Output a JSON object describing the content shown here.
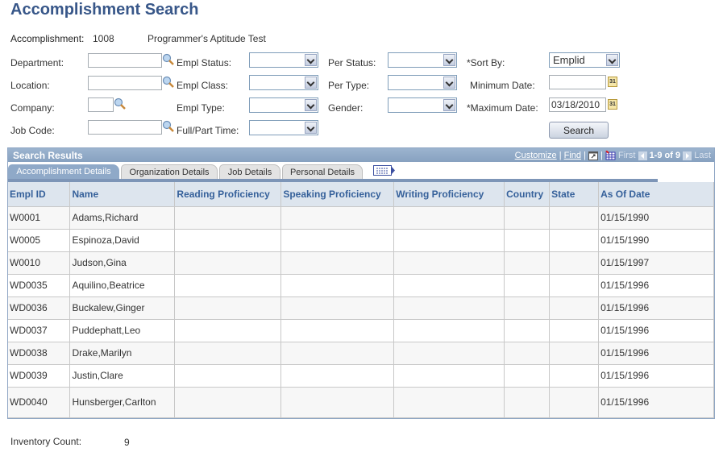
{
  "page": {
    "title": "Accomplishment Search"
  },
  "accomplishment": {
    "label": "Accomplishment:",
    "code": "1008",
    "description": "Programmer's Aptitude Test"
  },
  "criteria": {
    "department": {
      "label": "Department:",
      "value": ""
    },
    "location": {
      "label": "Location:",
      "value": ""
    },
    "company": {
      "label": "Company:",
      "value": ""
    },
    "job_code": {
      "label": "Job Code:",
      "value": ""
    },
    "empl_status": {
      "label": "Empl Status:",
      "value": ""
    },
    "empl_class": {
      "label": "Empl Class:",
      "value": ""
    },
    "empl_type": {
      "label": "Empl Type:",
      "value": ""
    },
    "full_part_time": {
      "label": "Full/Part Time:",
      "value": ""
    },
    "per_status": {
      "label": "Per Status:",
      "value": ""
    },
    "per_type": {
      "label": "Per Type:",
      "value": ""
    },
    "gender": {
      "label": "Gender:",
      "value": ""
    },
    "sort_by": {
      "label": "*Sort By:",
      "value": "Emplid"
    },
    "minimum_date": {
      "label": "Minimum Date:",
      "value": ""
    },
    "maximum_date": {
      "label": "*Maximum Date:",
      "value": "03/18/2010"
    },
    "search_button": "Search",
    "calendar_glyph": "31"
  },
  "results": {
    "title": "Search Results",
    "nav": {
      "customize": "Customize",
      "find": "Find",
      "sep": "|",
      "first": "First",
      "range": "1-9 of 9",
      "last": "Last"
    },
    "tabs": [
      "Accomplishment Details",
      "Organization Details",
      "Job Details",
      "Personal Details"
    ],
    "columns": [
      "Empl ID",
      "Name",
      "Reading Proficiency",
      "Speaking Proficiency",
      "Writing Proficiency",
      "Country",
      "State",
      "As Of Date"
    ],
    "rows": [
      [
        "W0001",
        "Adams,Richard",
        "",
        "",
        "",
        "",
        "",
        "01/15/1990"
      ],
      [
        "W0005",
        "Espinoza,David",
        "",
        "",
        "",
        "",
        "",
        "01/15/1990"
      ],
      [
        "W0010",
        "Judson,Gina",
        "",
        "",
        "",
        "",
        "",
        "01/15/1997"
      ],
      [
        "WD0035",
        "Aquilino,Beatrice",
        "",
        "",
        "",
        "",
        "",
        "01/15/1996"
      ],
      [
        "WD0036",
        "Buckalew,Ginger",
        "",
        "",
        "",
        "",
        "",
        "01/15/1996"
      ],
      [
        "WD0037",
        "Puddephatt,Leo",
        "",
        "",
        "",
        "",
        "",
        "01/15/1996"
      ],
      [
        "WD0038",
        "Drake,Marilyn",
        "",
        "",
        "",
        "",
        "",
        "01/15/1996"
      ],
      [
        "WD0039",
        "Justin,Clare",
        "",
        "",
        "",
        "",
        "",
        "01/15/1996"
      ],
      [
        "WD0040",
        "Hunsberger,Carlton",
        "",
        "",
        "",
        "",
        "",
        "01/15/1996"
      ]
    ]
  },
  "inventory": {
    "label": "Inventory Count:",
    "value": "9"
  }
}
